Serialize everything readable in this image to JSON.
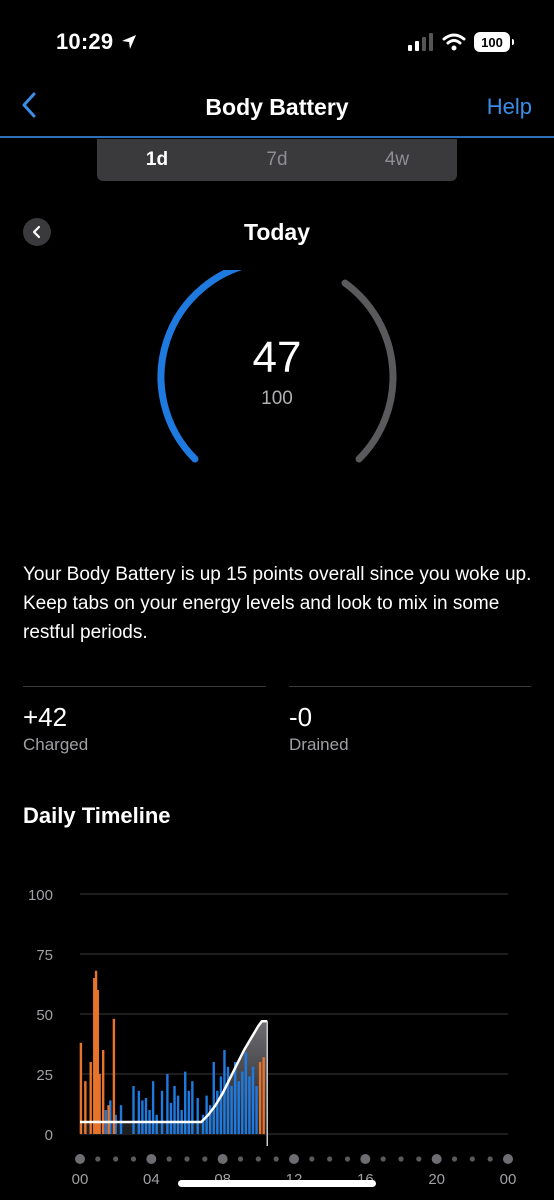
{
  "status_bar": {
    "time": "10:29",
    "battery": "100"
  },
  "nav": {
    "title": "Body Battery",
    "help": "Help"
  },
  "tabs": [
    {
      "label": "1d",
      "active": true
    },
    {
      "label": "7d",
      "active": false
    },
    {
      "label": "4w",
      "active": false
    }
  ],
  "day": {
    "label": "Today"
  },
  "gauge": {
    "value": "47",
    "max": "100",
    "fill_color": "#1f7ae0",
    "track_color": "#5a5a5c"
  },
  "description": "Your Body Battery is up 15 points overall since you woke up. Keep tabs on your energy levels and look to mix in some restful periods.",
  "stats": {
    "charged": {
      "value": "+42",
      "label": "Charged"
    },
    "drained": {
      "value": "-0",
      "label": "Drained"
    }
  },
  "timeline": {
    "title": "Daily Timeline"
  },
  "chart_data": {
    "type": "area",
    "title": "",
    "xlabel": "",
    "ylabel": "",
    "xlim": [
      0,
      24
    ],
    "ylim": [
      0,
      100
    ],
    "y_ticks": [
      "0",
      "25",
      "50",
      "75",
      "100"
    ],
    "x_ticks": [
      "00",
      "04",
      "08",
      "12",
      "16",
      "20",
      "00"
    ],
    "grid": true,
    "current_hour": 10.5,
    "colors": {
      "battery_fill": "#6e6e72",
      "battery_line": "#ffffff",
      "stress": "#e8742b",
      "rest": "#1f7ae0",
      "grid": "#3a3a3c"
    },
    "body_battery": {
      "x": [
        0,
        1,
        2,
        3,
        4,
        5,
        6,
        6.8,
        7.2,
        7.6,
        8.0,
        8.4,
        8.8,
        9.2,
        9.6,
        10.0,
        10.2,
        10.5
      ],
      "y": [
        5,
        5,
        5,
        5,
        5,
        5,
        5,
        5,
        8,
        12,
        17,
        23,
        29,
        35,
        40,
        45,
        47,
        47
      ]
    },
    "stress_bars": {
      "x": [
        0.05,
        0.3,
        0.6,
        0.8,
        0.9,
        1.0,
        1.1,
        1.3,
        1.6,
        1.9,
        10.1,
        10.3
      ],
      "y": [
        38,
        22,
        30,
        65,
        68,
        60,
        25,
        35,
        12,
        48,
        30,
        32
      ]
    },
    "rest_bars": {
      "x": [
        1.45,
        1.7,
        2.0,
        2.3,
        3.0,
        3.3,
        3.5,
        3.7,
        3.9,
        4.1,
        4.3,
        4.6,
        4.9,
        5.1,
        5.3,
        5.5,
        5.7,
        5.9,
        6.1,
        6.3,
        6.6,
        6.9,
        7.1,
        7.3,
        7.5,
        7.7,
        7.9,
        8.1,
        8.3,
        8.5,
        8.7,
        8.9,
        9.1,
        9.3,
        9.5,
        9.7,
        9.9
      ],
      "y": [
        10,
        14,
        8,
        12,
        20,
        18,
        14,
        15,
        10,
        22,
        8,
        18,
        25,
        13,
        20,
        16,
        10,
        26,
        18,
        22,
        15,
        8,
        16,
        12,
        30,
        18,
        24,
        35,
        28,
        20,
        30,
        22,
        26,
        34,
        24,
        28,
        20
      ]
    }
  }
}
